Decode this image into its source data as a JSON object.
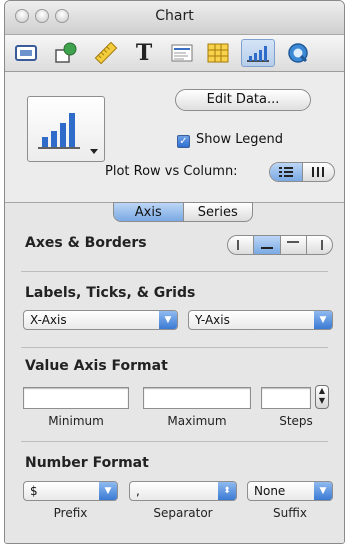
{
  "window": {
    "title": "Chart"
  },
  "toolbar": {
    "items": [
      {
        "name": "document-inspector",
        "icon": "document-icon"
      },
      {
        "name": "graphic-inspector",
        "icon": "shape-icon"
      },
      {
        "name": "metrics-inspector",
        "icon": "ruler-icon"
      },
      {
        "name": "text-inspector",
        "icon": "text-icon",
        "glyph": "T"
      },
      {
        "name": "layout-inspector",
        "icon": "layout-icon"
      },
      {
        "name": "table-inspector",
        "icon": "table-icon"
      },
      {
        "name": "chart-inspector",
        "icon": "chart-icon",
        "selected": true
      },
      {
        "name": "link-inspector",
        "icon": "quicktime-icon"
      }
    ]
  },
  "chart_options": {
    "edit_data_label": "Edit Data...",
    "show_legend_label": "Show Legend",
    "show_legend_checked": true,
    "plot_label": "Plot Row vs Column:"
  },
  "tabs": {
    "axis": "Axis",
    "series": "Series",
    "selected": "Axis"
  },
  "axes_borders": {
    "heading": "Axes & Borders"
  },
  "labels_section": {
    "heading": "Labels, Ticks, & Grids",
    "x_axis": "X-Axis",
    "y_axis": "Y-Axis"
  },
  "value_axis": {
    "heading": "Value Axis Format",
    "minimum": {
      "value": "",
      "caption": "Minimum"
    },
    "maximum": {
      "value": "",
      "caption": "Maximum"
    },
    "steps": {
      "value": "",
      "caption": "Steps"
    }
  },
  "number_format": {
    "heading": "Number Format",
    "prefix": {
      "value": "$",
      "caption": "Prefix"
    },
    "separator": {
      "value": ",",
      "caption": "Separator"
    },
    "suffix": {
      "value": "None",
      "caption": "Suffix"
    }
  },
  "colors": {
    "accent": "#3b7ad4",
    "selected_bg": "#b7cde9",
    "panel_bg": "#e6e6e6"
  }
}
